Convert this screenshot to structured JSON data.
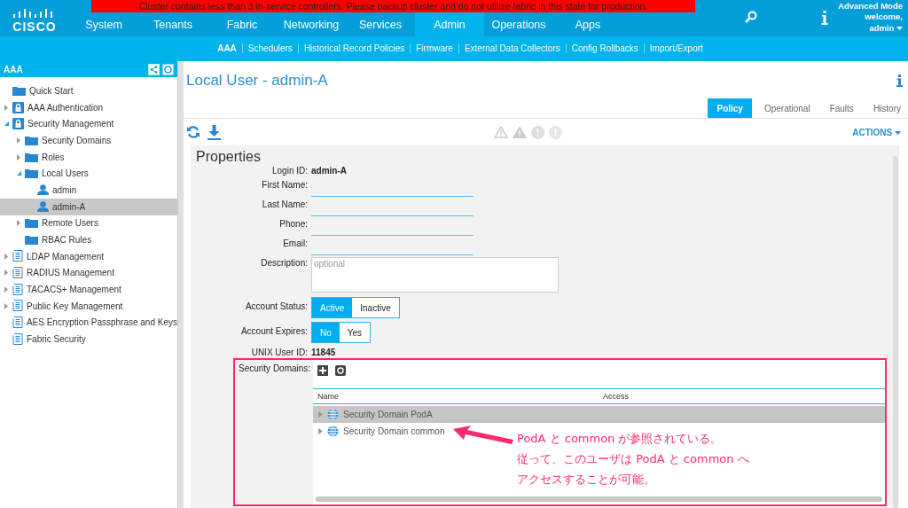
{
  "banner": "Cluster contains less than 3 in-service controllers. Please backup cluster and do not utilize fabric in this state for production.",
  "logo": "CISCO",
  "nav": [
    {
      "label": "System",
      "selected": false
    },
    {
      "label": "Tenants",
      "selected": false
    },
    {
      "label": "Fabric",
      "selected": false
    },
    {
      "label": "Networking",
      "selected": false
    },
    {
      "label": "Services",
      "selected": false
    },
    {
      "label": "Admin",
      "selected": true
    },
    {
      "label": "Operations",
      "selected": false
    },
    {
      "label": "Apps",
      "selected": false
    }
  ],
  "user_menu": {
    "mode": "Advanced Mode",
    "welcome": "welcome,",
    "user": "admin"
  },
  "subnav": [
    {
      "label": "AAA",
      "selected": true
    },
    {
      "label": "Schedulers",
      "selected": false
    },
    {
      "label": "Historical Record Policies",
      "selected": false
    },
    {
      "label": "Firmware",
      "selected": false
    },
    {
      "label": "External Data Collectors",
      "selected": false
    },
    {
      "label": "Config Rollbacks",
      "selected": false
    },
    {
      "label": "Import/Export",
      "selected": false
    }
  ],
  "sidebar": {
    "title": "AAA",
    "tree": [
      {
        "label": "Quick Start",
        "kind": "folder",
        "selected": false
      },
      {
        "label": "AAA Authentication",
        "kind": "lock",
        "expanded": false,
        "selected": false
      },
      {
        "label": "Security Management",
        "kind": "lock",
        "expanded": true,
        "selected": false,
        "children": [
          {
            "label": "Security Domains",
            "kind": "folder",
            "expanded": false,
            "selected": false
          },
          {
            "label": "Roles",
            "kind": "folder",
            "expanded": false,
            "selected": false
          },
          {
            "label": "Local Users",
            "kind": "folder",
            "expanded": true,
            "selected": false,
            "children": [
              {
                "label": "admin",
                "kind": "user",
                "selected": false
              },
              {
                "label": "admin-A",
                "kind": "user",
                "selected": true
              }
            ]
          },
          {
            "label": "Remote Users",
            "kind": "folder",
            "expanded": false,
            "selected": false
          },
          {
            "label": "RBAC Rules",
            "kind": "folder",
            "selected": false
          }
        ]
      },
      {
        "label": "LDAP Management",
        "kind": "doc",
        "expanded": false,
        "selected": false
      },
      {
        "label": "RADIUS Management",
        "kind": "doc",
        "expanded": false,
        "selected": false
      },
      {
        "label": "TACACS+ Management",
        "kind": "doc",
        "expanded": false,
        "selected": false
      },
      {
        "label": "Public Key Management",
        "kind": "doc",
        "expanded": false,
        "selected": false
      },
      {
        "label": "AES Encryption Passphrase and Keys",
        "kind": "doc",
        "selected": false
      },
      {
        "label": "Fabric Security",
        "kind": "doc",
        "selected": false
      }
    ]
  },
  "page_title": "Local User - admin-A",
  "tabs": [
    {
      "label": "Policy",
      "selected": true
    },
    {
      "label": "Operational",
      "selected": false
    },
    {
      "label": "Faults",
      "selected": false
    },
    {
      "label": "History",
      "selected": false
    }
  ],
  "actions": "ACTIONS",
  "section_title": "Properties",
  "fields": [
    {
      "label": "Login ID:",
      "kind": "text",
      "value": "admin-A"
    },
    {
      "label": "First Name:",
      "kind": "input"
    },
    {
      "label": "Last Name:",
      "kind": "input"
    },
    {
      "label": "Phone:",
      "kind": "input"
    },
    {
      "label": "Email:",
      "kind": "input"
    },
    {
      "label": "Description:",
      "kind": "textarea",
      "placeholder": "optional"
    },
    {
      "label": "Account Status:",
      "kind": "toggle",
      "options": [
        {
          "label": "Active",
          "selected": true
        },
        {
          "label": "Inactive",
          "selected": false
        }
      ]
    },
    {
      "label": "Account Expires:",
      "kind": "toggle",
      "options": [
        {
          "label": "No",
          "selected": true
        },
        {
          "label": "Yes",
          "selected": false
        }
      ]
    },
    {
      "label": "UNIX User ID:",
      "kind": "text",
      "value": "11845"
    }
  ],
  "security_domains": {
    "label": "Security Domains:",
    "columns": [
      "Name",
      "Access"
    ],
    "rows": [
      {
        "name": "Security Domain PodA",
        "selected": true
      },
      {
        "name": "Security Domain common",
        "selected": false
      }
    ]
  },
  "annotation": [
    "PodA と common が参照されている。",
    "従って、このユーザは PodA と common へ",
    "アクセスすることが可能。"
  ]
}
